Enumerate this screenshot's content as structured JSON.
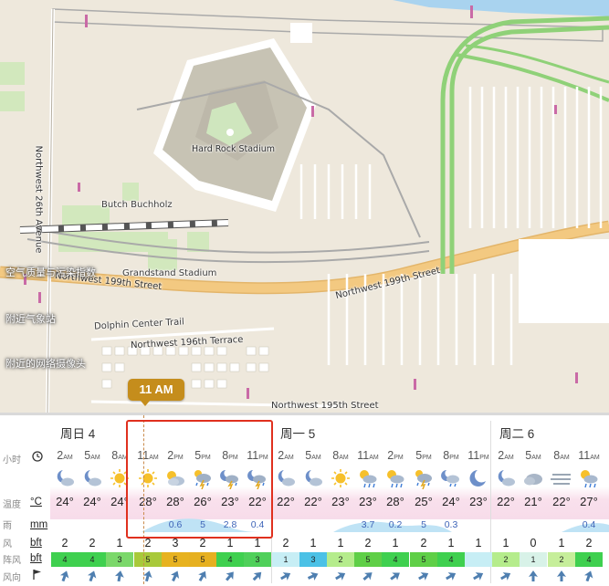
{
  "map": {
    "labels": {
      "stadium": "Hard Rock Stadium",
      "butch": "Butch Buchholz",
      "grandstand": "Grandstand Stadium",
      "nw26": "Northwest 26th Avenue",
      "nw199_left": "Northwest 199th Street",
      "nw199_right": "Northwest 199th Street",
      "dolphin": "Dolphin Center Trail",
      "nw196": "Northwest 196th Terrace",
      "nw195": "Northwest 195th Street"
    },
    "side_links": [
      "空气质量与污染指数",
      "附近气象站",
      "附近的网络摄像头"
    ]
  },
  "time_marker": "11 AM",
  "forecast": {
    "days": [
      "周日 4",
      "周一 5",
      "周二 6"
    ],
    "row_labels": {
      "hour": "小时",
      "temp": "温度",
      "temp_unit": "°C",
      "rain": "雨",
      "rain_unit": "mm",
      "wind": "风",
      "wind_unit": "bft",
      "gust": "阵风",
      "gust_unit": "bft",
      "dir": "风向"
    },
    "hours": [
      {
        "h": "2",
        "ap": "AM",
        "icon": "night-partly-cloudy-icon",
        "temp": "24°",
        "rain": "",
        "wind": "2",
        "gust": "4",
        "gustColor": "#3fd04f",
        "dir": 20
      },
      {
        "h": "5",
        "ap": "AM",
        "icon": "night-partly-cloudy-icon",
        "temp": "24°",
        "rain": "",
        "wind": "2",
        "gust": "4",
        "gustColor": "#3fd04f",
        "dir": 20
      },
      {
        "h": "8",
        "ap": "AM",
        "icon": "sunny-icon",
        "temp": "24°",
        "rain": "",
        "wind": "1",
        "gust": "3",
        "gustColor": "#7bd86a",
        "dir": 10
      },
      {
        "h": "11",
        "ap": "AM",
        "icon": "sunny-icon",
        "temp": "28°",
        "rain": "",
        "wind": "2",
        "gust": "5",
        "gustColor": "#a8c93a",
        "dir": 15
      },
      {
        "h": "2",
        "ap": "PM",
        "icon": "partly-cloudy-icon",
        "temp": "28°",
        "rain": "0.6",
        "wind": "3",
        "gust": "5",
        "gustColor": "#e7b21f",
        "dir": 25
      },
      {
        "h": "5",
        "ap": "PM",
        "icon": "thunder-rain-icon",
        "temp": "26°",
        "rain": "5",
        "wind": "2",
        "gust": "5",
        "gustColor": "#e6b020",
        "dir": 30
      },
      {
        "h": "8",
        "ap": "PM",
        "icon": "night-thunder-icon",
        "temp": "23°",
        "rain": "2.8",
        "wind": "1",
        "gust": "4",
        "gustColor": "#3fd04f",
        "dir": 40
      },
      {
        "h": "11",
        "ap": "PM",
        "icon": "night-thunder-icon",
        "temp": "22°",
        "rain": "0.4",
        "wind": "1",
        "gust": "3",
        "gustColor": "#4fd05a",
        "dir": 45
      },
      {
        "h": "2",
        "ap": "AM",
        "icon": "night-partly-cloudy-icon",
        "temp": "22°",
        "rain": "",
        "wind": "2",
        "gust": "1",
        "gustColor": "#c7eef5",
        "dir": 60
      },
      {
        "h": "5",
        "ap": "AM",
        "icon": "night-partly-cloudy-icon",
        "temp": "22°",
        "rain": "",
        "wind": "1",
        "gust": "3",
        "gustColor": "#4bc1e6",
        "dir": 65
      },
      {
        "h": "8",
        "ap": "AM",
        "icon": "sunny-icon",
        "temp": "23°",
        "rain": "",
        "wind": "1",
        "gust": "2",
        "gustColor": "#b5ec8c",
        "dir": 60
      },
      {
        "h": "11",
        "ap": "AM",
        "icon": "sun-rain-icon",
        "temp": "23°",
        "rain": "3.7",
        "wind": "2",
        "gust": "5",
        "gustColor": "#5fcf47",
        "dir": 50
      },
      {
        "h": "2",
        "ap": "PM",
        "icon": "sun-rain-icon",
        "temp": "28°",
        "rain": "0.2",
        "wind": "1",
        "gust": "4",
        "gustColor": "#3fd04f",
        "dir": 55
      },
      {
        "h": "5",
        "ap": "PM",
        "icon": "thunder-rain-icon",
        "temp": "25°",
        "rain": "5",
        "wind": "2",
        "gust": "5",
        "gustColor": "#5fcf47",
        "dir": 60
      },
      {
        "h": "8",
        "ap": "PM",
        "icon": "night-rain-icon",
        "temp": "24°",
        "rain": "0.3",
        "wind": "1",
        "gust": "4",
        "gustColor": "#3fd04f",
        "dir": 60
      },
      {
        "h": "11",
        "ap": "PM",
        "icon": "night-moon-icon",
        "temp": "23°",
        "rain": "",
        "wind": "1",
        "gust": "",
        "gustColor": "#c7eef5",
        "dir": 60
      },
      {
        "h": "2",
        "ap": "AM",
        "icon": "night-partly-cloudy-icon",
        "temp": "22°",
        "rain": "",
        "wind": "1",
        "gust": "2",
        "gustColor": "#b5ec8c",
        "dir": 60
      },
      {
        "h": "5",
        "ap": "AM",
        "icon": "cloudy-icon",
        "temp": "21°",
        "rain": "",
        "wind": "0",
        "gust": "1",
        "gustColor": "#d8f2e8",
        "dir": 0
      },
      {
        "h": "8",
        "ap": "AM",
        "icon": "fog-icon",
        "temp": "22°",
        "rain": "",
        "wind": "1",
        "gust": "2",
        "gustColor": "#c6ee9a",
        "dir": 0
      },
      {
        "h": "11",
        "ap": "AM",
        "icon": "sun-rain-icon",
        "temp": "27°",
        "rain": "0.4",
        "wind": "2",
        "gust": "4",
        "gustColor": "#3fd04f",
        "dir": 20
      }
    ]
  },
  "colors": {
    "accent": "#c58d1c",
    "selection": "#e0301e",
    "rain_text": "#3e64b8",
    "road_main": "#f3c981",
    "highway": "#8fd178"
  }
}
